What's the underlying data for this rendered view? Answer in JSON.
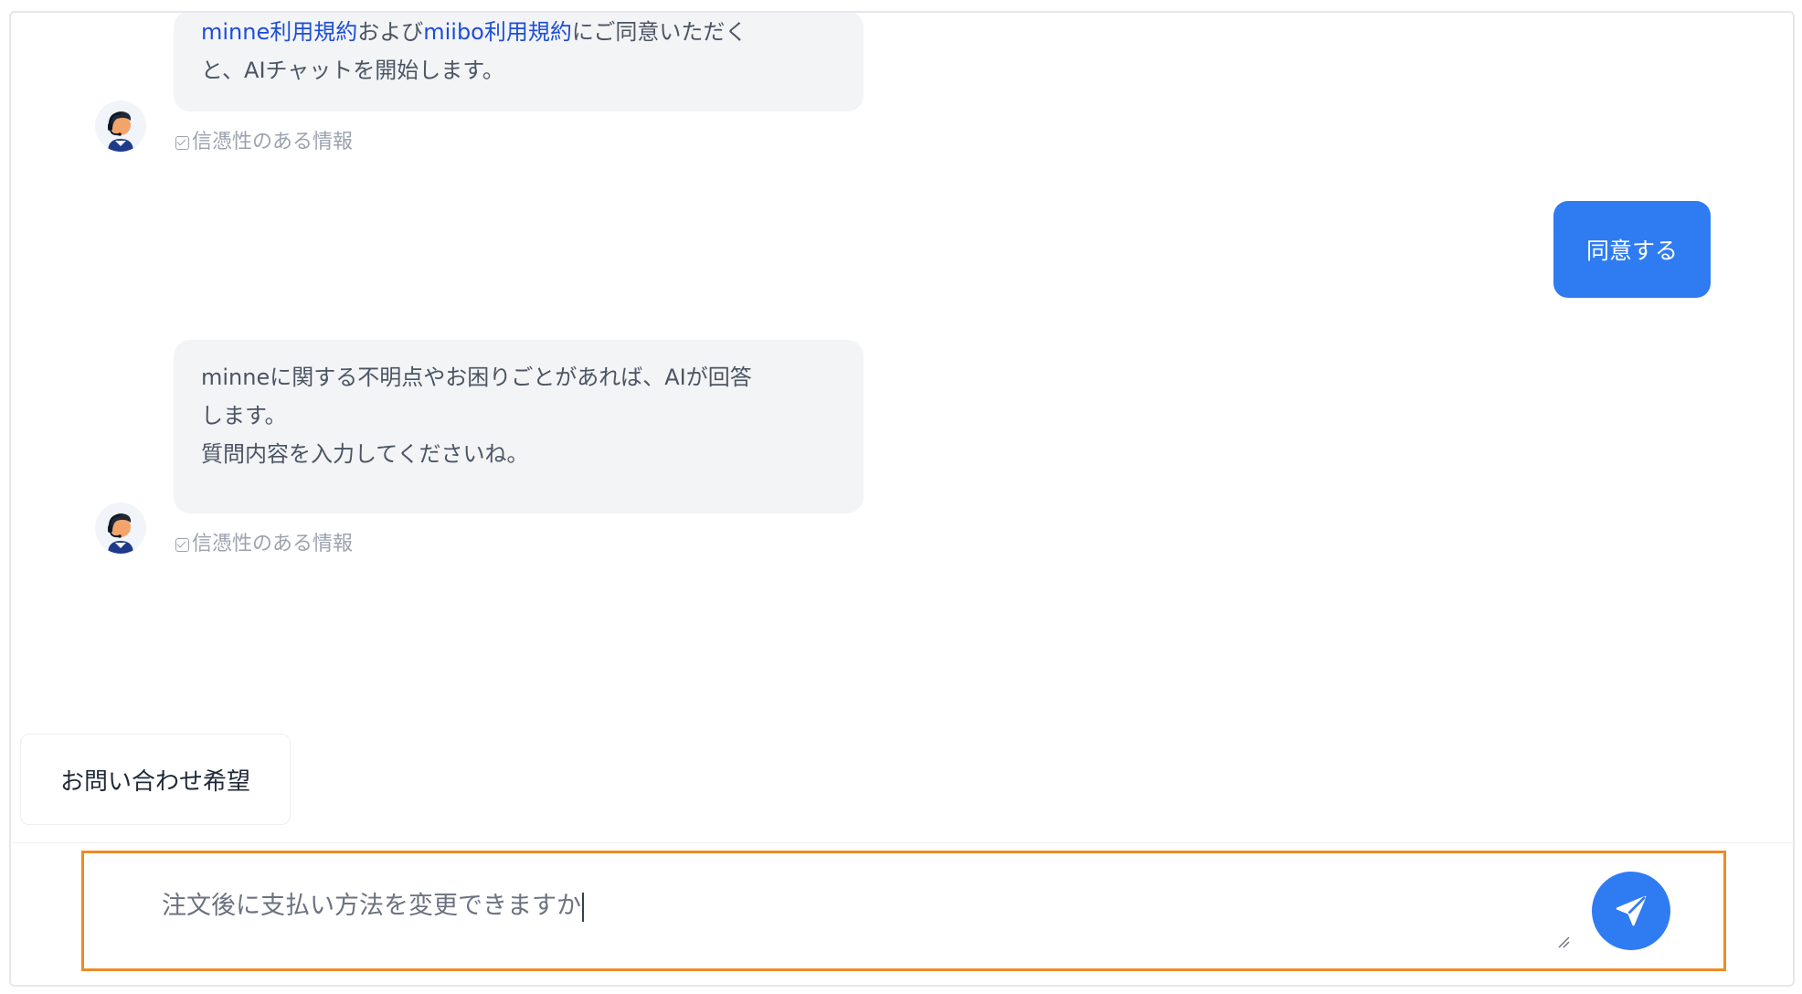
{
  "messages": {
    "bot1": {
      "link1": "minne利用規約",
      "text1": "および",
      "link2": "miibo利用規約",
      "text2": "にご同意いただく",
      "line2": "と、AIチャットを開始します。",
      "reliability": "信憑性のある情報"
    },
    "user1": "同意する",
    "bot2": {
      "line1": "minneに関する不明点やお困りごとがあれば、AIが回答",
      "line2": "します。",
      "line3": "質問内容を入力してくださいね。",
      "reliability": "信憑性のある情報"
    }
  },
  "quick_reply": "お問い合わせ希望",
  "input": {
    "value": "注文後に支払い方法を変更できますか"
  },
  "colors": {
    "accent": "#2f7cf2",
    "input_border": "#f08a24",
    "bot_bubble": "#f3f4f6",
    "link": "#1d4ed8"
  },
  "icons": {
    "avatar": "operator-headset-avatar",
    "check": "checkbox-check-icon",
    "send": "paper-plane-icon",
    "resize": "resize-handle-icon"
  }
}
